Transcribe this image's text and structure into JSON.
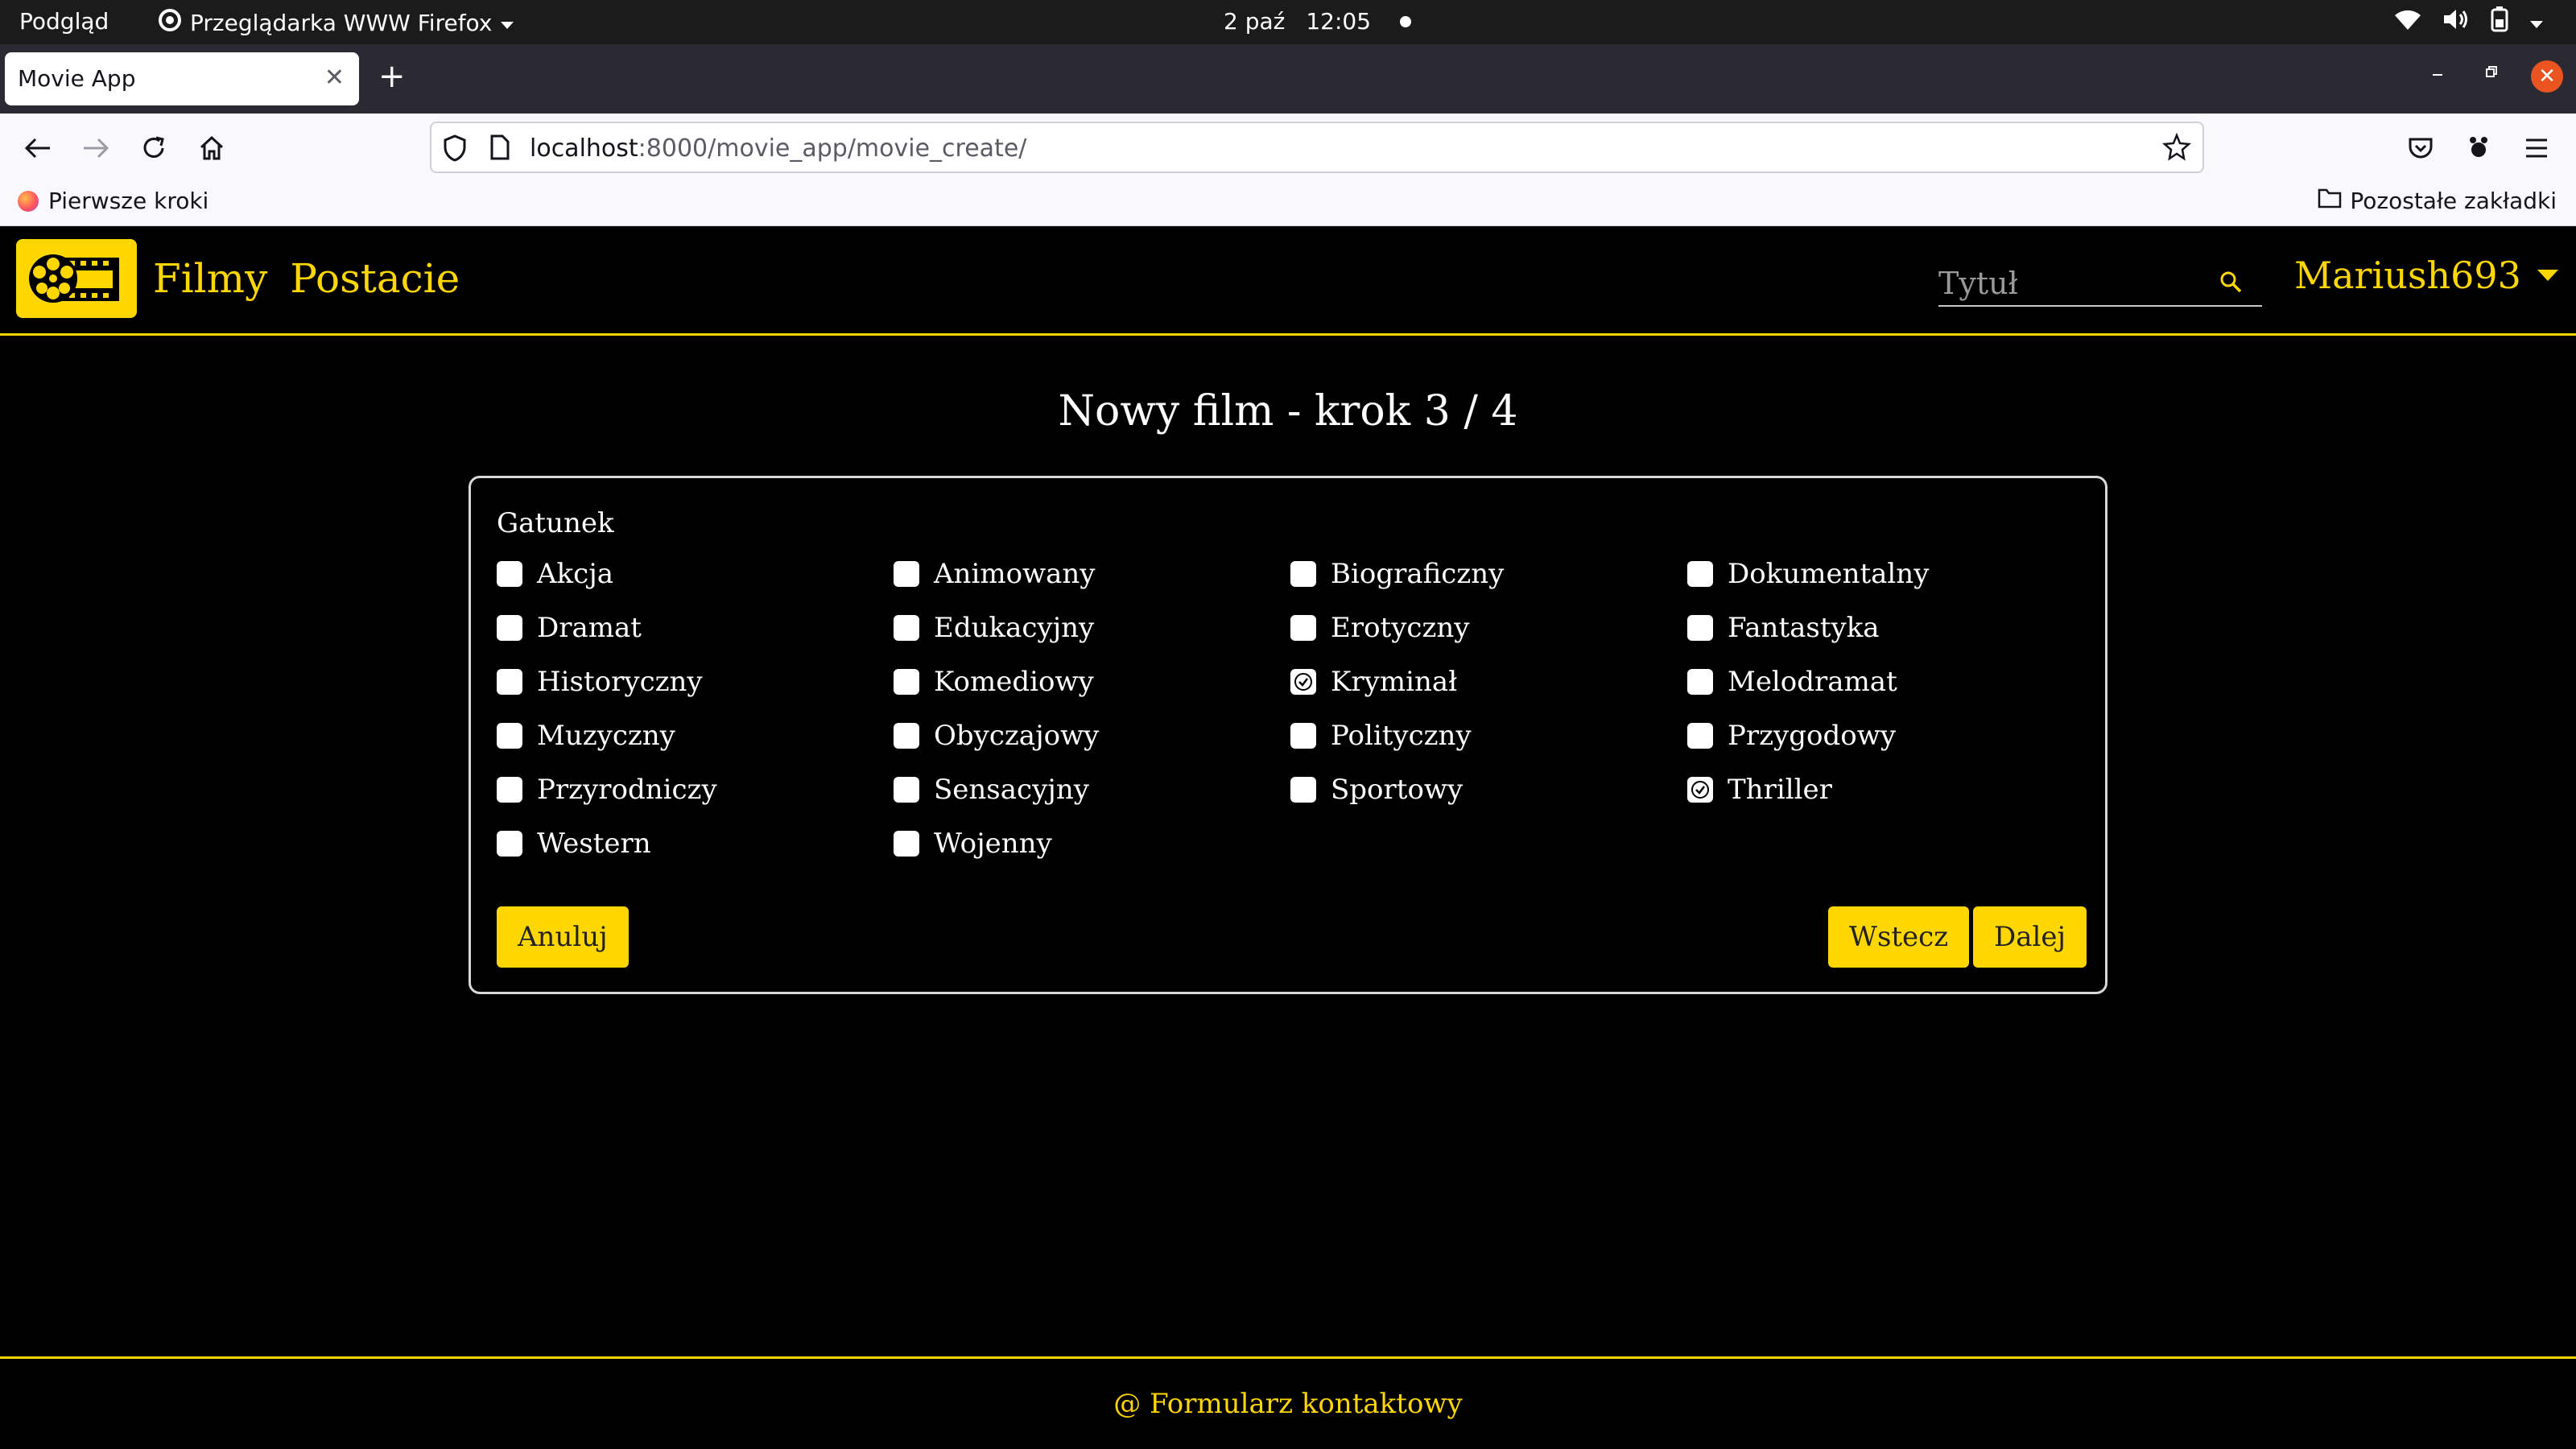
{
  "system_bar": {
    "activities": "Podgląd",
    "app_name": "Przeglądarka WWW Firefox",
    "date": "2 paź",
    "time": "12:05"
  },
  "browser": {
    "tab_title": "Movie App",
    "url_host": "localhost",
    "url_path": ":8000/movie_app/movie_create/",
    "bookmark_left": "Pierwsze kroki",
    "bookmark_right": "Pozostałe zakładki"
  },
  "site": {
    "nav": [
      "Filmy",
      "Postacie"
    ],
    "search_placeholder": "Tytuł",
    "username": "Mariush693",
    "accent_color": "#ffd700"
  },
  "form": {
    "title": "Nowy film - krok 3 / 4",
    "legend": "Gatunek",
    "genres": [
      {
        "label": "Akcja",
        "checked": false
      },
      {
        "label": "Animowany",
        "checked": false
      },
      {
        "label": "Biograficzny",
        "checked": false
      },
      {
        "label": "Dokumentalny",
        "checked": false
      },
      {
        "label": "Dramat",
        "checked": false
      },
      {
        "label": "Edukacyjny",
        "checked": false
      },
      {
        "label": "Erotyczny",
        "checked": false
      },
      {
        "label": "Fantastyka",
        "checked": false
      },
      {
        "label": "Historyczny",
        "checked": false
      },
      {
        "label": "Komediowy",
        "checked": false
      },
      {
        "label": "Kryminał",
        "checked": true
      },
      {
        "label": "Melodramat",
        "checked": false
      },
      {
        "label": "Muzyczny",
        "checked": false
      },
      {
        "label": "Obyczajowy",
        "checked": false
      },
      {
        "label": "Polityczny",
        "checked": false
      },
      {
        "label": "Przygodowy",
        "checked": false
      },
      {
        "label": "Przyrodniczy",
        "checked": false
      },
      {
        "label": "Sensacyjny",
        "checked": false
      },
      {
        "label": "Sportowy",
        "checked": false
      },
      {
        "label": "Thriller",
        "checked": true
      },
      {
        "label": "Western",
        "checked": false
      },
      {
        "label": "Wojenny",
        "checked": false
      }
    ],
    "cancel_label": "Anuluj",
    "back_label": "Wstecz",
    "next_label": "Dalej"
  },
  "footer": {
    "contact": "@ Formularz kontaktowy"
  }
}
